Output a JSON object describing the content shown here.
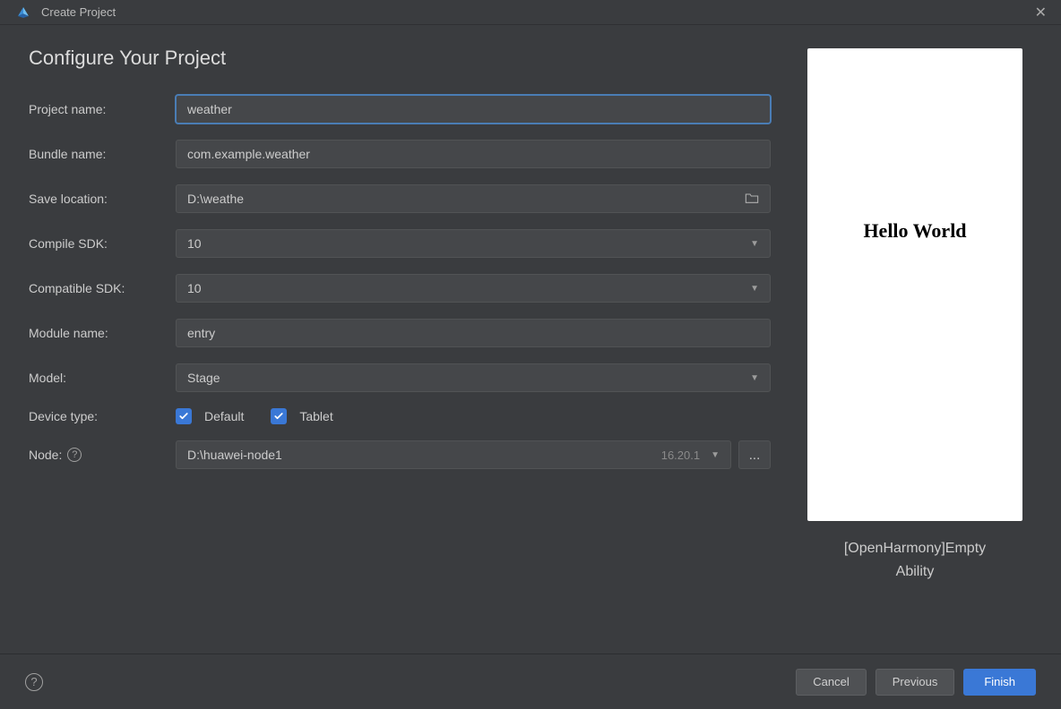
{
  "window": {
    "title": "Create Project"
  },
  "heading": "Configure Your Project",
  "form": {
    "project_name": {
      "label": "Project name:",
      "value": "weather"
    },
    "bundle_name": {
      "label": "Bundle name:",
      "value": "com.example.weather"
    },
    "save_location": {
      "label": "Save location:",
      "value": "D:\\weathe"
    },
    "compile_sdk": {
      "label": "Compile SDK:",
      "value": "10"
    },
    "compat_sdk": {
      "label": "Compatible SDK:",
      "value": "10"
    },
    "module_name": {
      "label": "Module name:",
      "value": "entry"
    },
    "model": {
      "label": "Model:",
      "value": "Stage"
    },
    "device_type": {
      "label": "Device type:",
      "options": [
        {
          "label": "Default",
          "checked": true
        },
        {
          "label": "Tablet",
          "checked": true
        }
      ]
    },
    "node": {
      "label": "Node:",
      "value": "D:\\huawei-node1",
      "version": "16.20.1",
      "browse": "..."
    }
  },
  "preview": {
    "hello": "Hello World",
    "caption_line1": "[OpenHarmony]Empty",
    "caption_line2": "Ability"
  },
  "footer": {
    "cancel": "Cancel",
    "previous": "Previous",
    "finish": "Finish"
  }
}
